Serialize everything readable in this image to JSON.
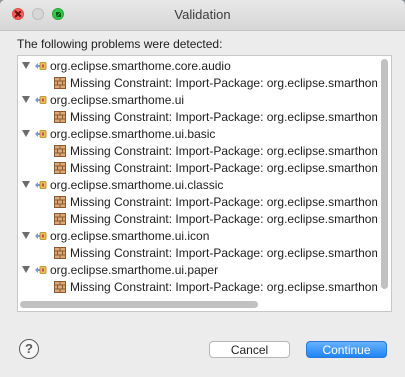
{
  "dialog": {
    "title": "Validation",
    "message": "The following problems were detected:",
    "help_label": "?",
    "cancel_label": "Cancel",
    "continue_label": "Continue",
    "accent_color": "#1f85f5"
  },
  "tree": {
    "items": [
      {
        "label": "org.eclipse.smarthome.core.audio",
        "children": [
          "Missing Constraint: Import-Package: org.eclipse.smarthom"
        ]
      },
      {
        "label": "org.eclipse.smarthome.ui",
        "children": [
          "Missing Constraint: Import-Package: org.eclipse.smarthom"
        ]
      },
      {
        "label": "org.eclipse.smarthome.ui.basic",
        "children": [
          "Missing Constraint: Import-Package: org.eclipse.smarthom",
          "Missing Constraint: Import-Package: org.eclipse.smarthom"
        ]
      },
      {
        "label": "org.eclipse.smarthome.ui.classic",
        "children": [
          "Missing Constraint: Import-Package: org.eclipse.smarthom",
          "Missing Constraint: Import-Package: org.eclipse.smarthom"
        ]
      },
      {
        "label": "org.eclipse.smarthome.ui.icon",
        "children": [
          "Missing Constraint: Import-Package: org.eclipse.smarthom"
        ]
      },
      {
        "label": "org.eclipse.smarthome.ui.paper",
        "children": [
          "Missing Constraint: Import-Package: org.eclipse.smarthom"
        ]
      }
    ],
    "parent_icon": "plugin-error-icon",
    "child_icon": "constraint-icon",
    "expander_icon": "expanded-triangle-icon"
  }
}
